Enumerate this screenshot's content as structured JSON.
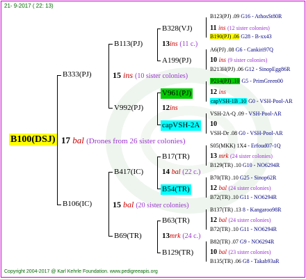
{
  "header": {
    "date_label": "21- 9-2017 ( 22: 13)"
  },
  "footer": {
    "copyright": "Copyright 2004-2017 @ Karl Kehrle Foundation.   www.pedigreeapis.org"
  },
  "root": {
    "name": "B100(DSJ)",
    "num": "17",
    "breed": "bal",
    "sisters": "(Drones from 26 sister colonies)"
  },
  "gen1": {
    "top": {
      "name": "B333(PJ)",
      "num": "15",
      "breed": "ins",
      "sisters": "(10 sister colonies)"
    },
    "bottom": {
      "name": "B106(IC)",
      "num": "15",
      "breed": "bal",
      "sisters": "(20 sister colonies)"
    }
  },
  "gen2": {
    "a": {
      "name": "B113(PJ)",
      "num": "13",
      "breed": "ins",
      "sisters": "(11 c.)"
    },
    "b": {
      "name": "V992(PJ)",
      "num": "12",
      "breed": "ins",
      "sisters": ""
    },
    "c": {
      "name": "B417(IC)",
      "num": "14",
      "breed": "bal",
      "sisters": "(22 c.)"
    },
    "d": {
      "name": "B69(TR)",
      "num": "13",
      "breed": "mrk",
      "sisters": "(24 c.)"
    }
  },
  "gen3": {
    "a": {
      "name": "B328(VJ)",
      "num": "11",
      "breed": "ins",
      "sisters": "(12 sister colonies)"
    },
    "b": {
      "name": "A199(PJ)",
      "num": "10",
      "breed": "ins",
      "sisters": "(9 sister colonies)"
    },
    "c": {
      "name": "V961(PJ)",
      "num": "12",
      "breed": "ins",
      "sisters": ""
    },
    "d": {
      "name": "capVSH-2A",
      "num": "10",
      "breed": "",
      "sisters": ""
    },
    "e": {
      "name": "B17(TR)",
      "num": "13",
      "breed": "mrk",
      "sisters": "(24 sister colonies)"
    },
    "f": {
      "name": "B54(TR)",
      "num": "12",
      "breed": "bal",
      "sisters": "(24 sister colonies)"
    },
    "g": {
      "name": "B63(TR)",
      "num": "12",
      "breed": "bal",
      "sisters": "(24 sister colonies)"
    },
    "h": {
      "name": "B129(TR)",
      "num": "10",
      "breed": "bal",
      "sisters": "(23 sister colonies)"
    }
  },
  "gen4": [
    {
      "name": "B123(PJ)",
      "num": ".09",
      "father": "G16 - AthosSt80R"
    },
    {
      "name": "B190(PJ)",
      "num": ".06",
      "father": "G28 - B-xx43"
    },
    {
      "name": "A6(PJ)",
      "num": ".08",
      "father": "G6 - Cankiri97Q"
    },
    {
      "name": "B213H(PJ)",
      "num": ".06",
      "father": "G12 - SinopEgg86R"
    },
    {
      "name": "P214(PJ)",
      "num": ".10",
      "father": "G5 - PrimGreen00"
    },
    {
      "name": "capVSH-1B",
      "num": ".10",
      "father": "G0 - VSH-Pool-AR"
    },
    {
      "name": "VSH-2A-Q",
      "num": ".09",
      "father": "- VSH-Pool-AR"
    },
    {
      "name": "VSH-Dr",
      "num": ".08",
      "father": "G0 - VSH-Pool-AR"
    },
    {
      "name": "S05(MKK)",
      "num": "1X4",
      "father": "- Erfoud07-1Q"
    },
    {
      "name": "B129(TR)",
      "num": ".10",
      "father": "G10 - NO6294R"
    },
    {
      "name": "B70(TR)",
      "num": ".10",
      "father": "G25 - Sinop62R"
    },
    {
      "name": "B72(TR)",
      "num": ".10",
      "father": "G11 - NO6294R"
    },
    {
      "name": "B137(TR)",
      "num": ".13",
      "father": "8 - Kangaroo98R"
    },
    {
      "name": "B72(TR)",
      "num": ".10",
      "father": "G11 - NO6294R"
    },
    {
      "name": "B82(TR)",
      "num": ".07",
      "father": "G9 - NO6294R"
    },
    {
      "name": "B135(TR)",
      "num": ".06",
      "father": "G8 - Takab93aR"
    }
  ],
  "colors": {
    "frame": "#cc00cc",
    "root_highlight": "#ffff00",
    "green_highlight": "#00cc00",
    "cyan_highlight": "#00ffff",
    "breed_text": "#cc0000",
    "sister_text": "#9933cc",
    "father_text": "#000080"
  }
}
